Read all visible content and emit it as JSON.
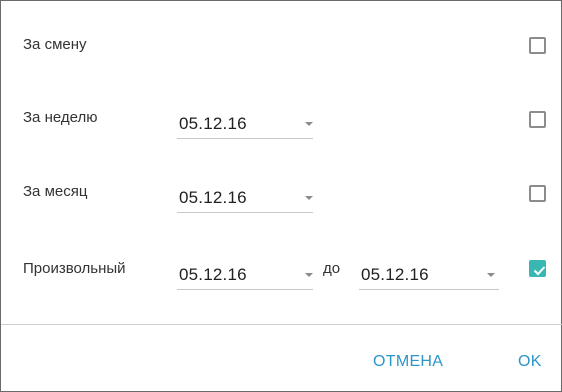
{
  "rows": [
    {
      "label": "За смену",
      "checked": false
    },
    {
      "label": "За неделю",
      "date": "05.12.16",
      "checked": false
    },
    {
      "label": "За месяц",
      "date": "05.12.16",
      "checked": false
    },
    {
      "label": "Произвольный",
      "date_from": "05.12.16",
      "separator": "до",
      "date_to": "05.12.16",
      "checked": true
    }
  ],
  "actions": {
    "cancel_label": "ОТМЕНА",
    "ok_label": "OK"
  },
  "colors": {
    "accent": "#39b7b2",
    "button_text": "#2a95c8",
    "checkbox_border": "#8c8c8c"
  },
  "icons": {
    "dropdown": "caret-down-icon",
    "check": "checkmark-icon"
  }
}
